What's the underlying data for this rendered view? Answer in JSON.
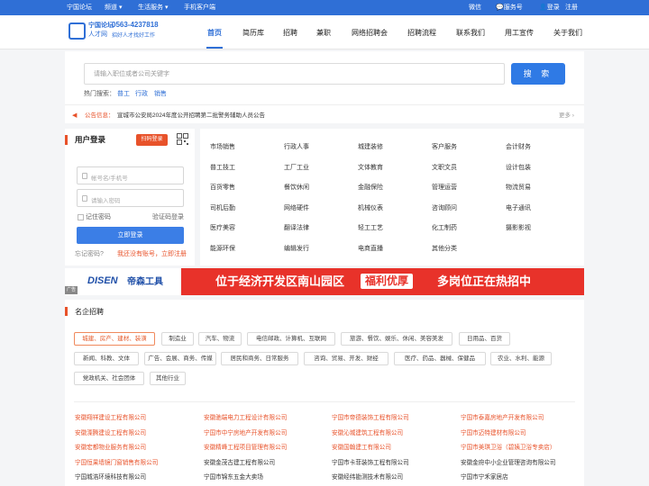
{
  "topbar": {
    "site_name": "宁国论坛",
    "channel": "频道",
    "life_service": "生活服务",
    "mobile": "手机客户端",
    "wechat": "微信",
    "service_account": "服务号",
    "login": "登录",
    "register": "注册"
  },
  "logo": {
    "line1": "宁国论坛",
    "line2": "人才网",
    "phone": "0563-4237818",
    "slogan": "招好人才找好工作"
  },
  "nav": [
    "首页",
    "简历库",
    "招聘",
    "兼职",
    "网络招聘会",
    "招聘流程",
    "联系我们",
    "用工宣传",
    "关于我们"
  ],
  "search": {
    "placeholder": "请输入职位或者公司关键字",
    "button": "搜 索",
    "hot_label": "热门搜索：",
    "hot": [
      "普工",
      "行政",
      "销售"
    ]
  },
  "notice": {
    "label": "公告信息：",
    "text": "宣城市公安局2024年度公开招聘第二批警务辅助人员公告",
    "more": "更多 ›"
  },
  "login": {
    "title": "用户登录",
    "scan_label": "扫码登录",
    "username_placeholder": "帐号名/手机号",
    "password_placeholder": "请输入密码",
    "remember": "记住密码",
    "sms_login": "验证码登录",
    "submit": "立即登录",
    "forgot": "忘记密码?",
    "register_prompt": "我还没有账号，立即注册"
  },
  "categories": [
    [
      "市场销售",
      "行政人事",
      "城建装修",
      "客户服务",
      "会计财务"
    ],
    [
      "普工技工",
      "工厂工业",
      "文体教育",
      "文职文员",
      "设计包装"
    ],
    [
      "百货零售",
      "餐饮休闲",
      "金融保险",
      "管理运营",
      "物流贸易"
    ],
    [
      "司机后勤",
      "网络硬件",
      "机械仪表",
      "咨询顾问",
      "电子通讯"
    ],
    [
      "医疗美容",
      "翻译法律",
      "轻工工艺",
      "化工制药",
      "摄影影视"
    ],
    [
      "能源环保",
      "编辑发行",
      "电商直播",
      "其他分类"
    ]
  ],
  "banner": {
    "brand_en": "DISEN",
    "brand_cn": "帝森工具",
    "headline": "位于经济开发区南山园区",
    "badge": "福利优厚",
    "hiring": "多岗位正在热招中",
    "tag": "广告"
  },
  "famous": {
    "title": "名企招聘",
    "industries": [
      [
        "城建、房产、建材、装潢",
        "制造业",
        "汽车、物流",
        "电信邮政、计算机、互联网",
        "旅游、餐饮、娱乐、休闲、美容美发",
        "日用品、百货"
      ],
      [
        "新闻、科教、文体",
        "广告、会展、商务、传媒",
        "居民和商务、日常服务",
        "咨询、贸易、开发、财经",
        "医疗、药品、器械、保健品",
        "农业、水利、能源"
      ],
      [
        "党政机关、社会团体",
        "其他行业"
      ]
    ],
    "companies": [
      [
        "安徽翔祥建设工程有限公司",
        "安徽驰端电力工程设计有限公司",
        "宁国市帝德装饰工程有限公司",
        "宁国市泰嘉房地产开发有限公司"
      ],
      [
        "安徽溧腾建设工程有限公司",
        "宁国市中宁房地产开发有限公司",
        "安徽沁城建筑工程有限公司",
        "宁国市迈特建材有限公司"
      ],
      [
        "安徽宏都物业服务有限公司",
        "安徽精峰工程项目管理有限公司",
        "安徽国翰建工有限公司",
        "宁国市美琪卫浴（碧姨卫浴专卖店）"
      ],
      [
        "宁国恒果墙镜门窗销售有限公司",
        "安徽金茂古建工程有限公司",
        "宁国市卡菲装饰工程有限公司",
        "安徽金府中小企业管理咨询有限公司"
      ],
      [
        "宁国城浩环境科技有限公司",
        "宁国市锦东五金大卖场",
        "安徽经纬勘测技术有限公司",
        "宁国市宁禾家居店"
      ]
    ]
  },
  "colors": {
    "brand_blue": "#2f6fd6",
    "accent_orange": "#e8522a",
    "banner_red": "#e8322a"
  }
}
